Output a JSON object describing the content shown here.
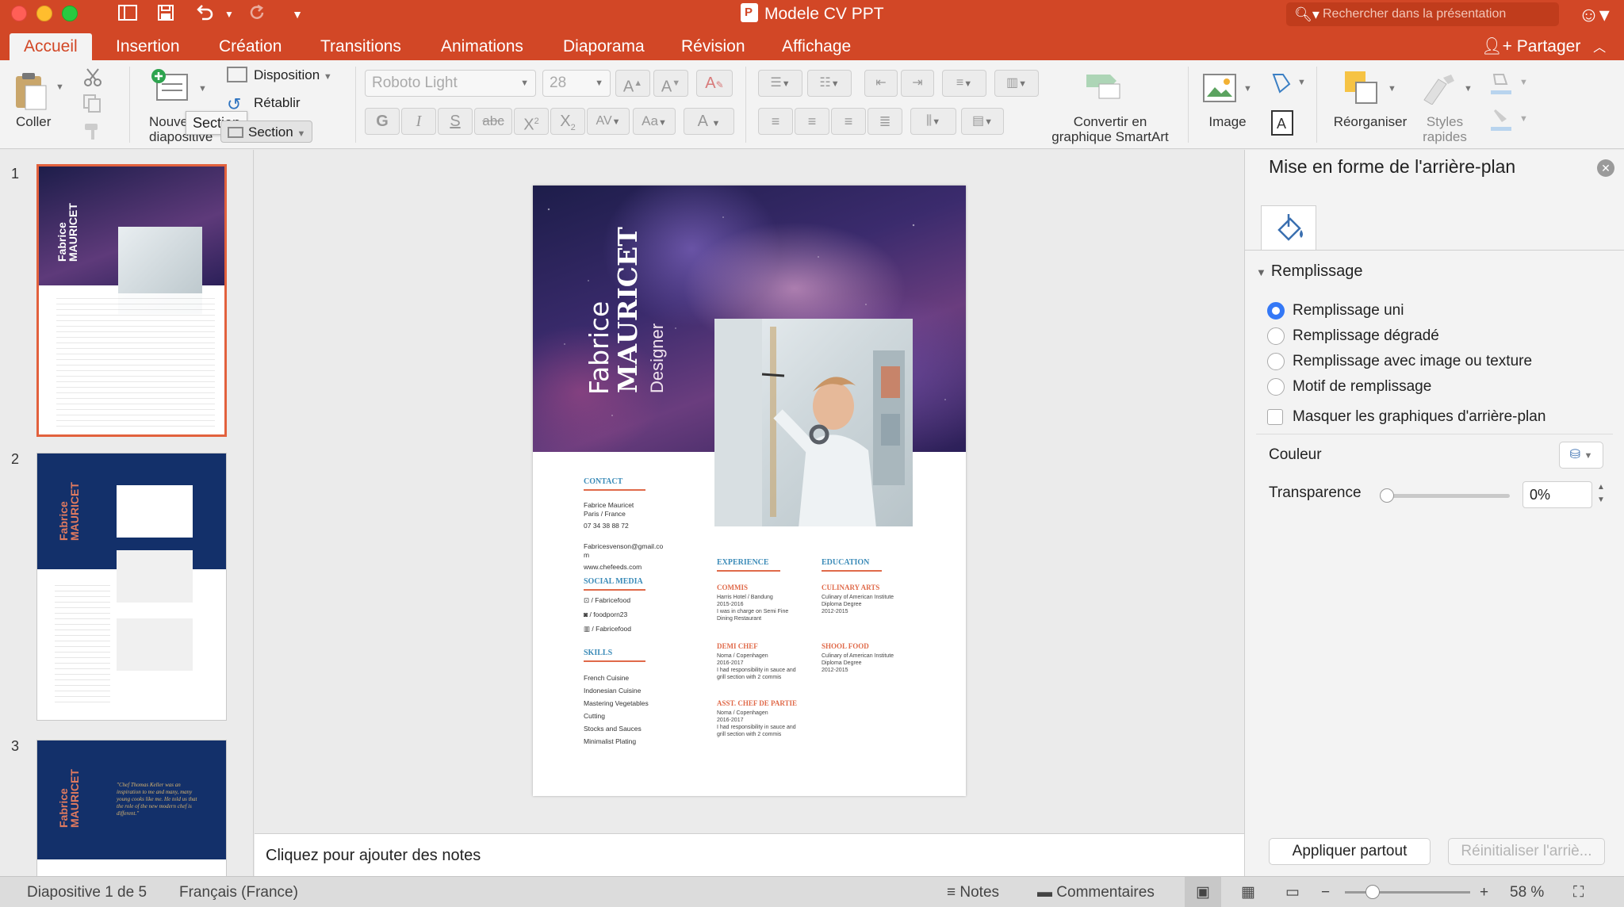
{
  "window": {
    "title": "Modele CV PPT",
    "search_placeholder": "Rechercher dans la présentation"
  },
  "tabs": [
    "Accueil",
    "Insertion",
    "Création",
    "Transitions",
    "Animations",
    "Diaporama",
    "Révision",
    "Affichage"
  ],
  "share_label": "Partager",
  "ribbon": {
    "paste_label": "Coller",
    "new_slide_label_1": "Nouve",
    "new_slide_label_2": "diapositive",
    "tooltip": "Section",
    "layout_label": "Disposition",
    "reset_label": "Rétablir",
    "section_label": "Section",
    "font_name": "Roboto Light",
    "font_size": "28",
    "convert_smartart_1": "Convertir en",
    "convert_smartart_2": "graphique SmartArt",
    "image_label": "Image",
    "arrange_label": "Réorganiser",
    "quick_styles_1": "Styles",
    "quick_styles_2": "rapides"
  },
  "thumbnails": {
    "numbers": [
      "1",
      "2",
      "3"
    ],
    "slide2_name1": "Fabrice",
    "slide2_name2": "MAURICET",
    "slide3_quote": "\"Chef Thomas Keller was an inspiration to me and many, many young cooks like me. He told us that the role of the new modern chef is different.\""
  },
  "slide": {
    "first_name": "Fabrice",
    "last_name": "MAURICET",
    "role": "Designer",
    "contact": {
      "heading": "CONTACT",
      "name": "Fabrice Mauricet",
      "city": "Paris / France",
      "phone": "07 34 38 88 72",
      "email_1": "Fabricesvenson@gmail.co",
      "email_2": "m",
      "website": "www.chefeeds.com"
    },
    "social": {
      "heading": "SOCIAL MEDIA",
      "items": [
        "/ Fabricefood",
        "/ foodporn23",
        "/ Fabricefood"
      ]
    },
    "skills": {
      "heading": "SKILLS",
      "items": [
        "French Cuisine",
        "Indonesian Cuisine",
        "Mastering Vegetables",
        "Cutting",
        "Stocks and Sauces",
        "Minimalist Plating"
      ]
    },
    "experience": {
      "heading": "EXPERIENCE",
      "jobs": [
        {
          "title": "COMMIS",
          "lines": [
            "Harris Hotel / Bandung",
            "2015-2016",
            "I was in charge on Semi Fine",
            "Dining Restaurant"
          ]
        },
        {
          "title": "DEMI CHEF",
          "lines": [
            "Noma / Copenhagen",
            "2016-2017",
            "I had responsibility in sauce and",
            "grill section with 2 commis"
          ]
        },
        {
          "title": "ASST. CHEF DE PARTIE",
          "lines": [
            "Noma / Copenhagen",
            "2016-2017",
            "I had responsibility in sauce and",
            "grill section with 2 commis"
          ]
        }
      ]
    },
    "education": {
      "heading": "EDUCATION",
      "items": [
        {
          "title": "CULINARY ARTS",
          "lines": [
            "Culinary of American Institute",
            "Diploma Degree",
            "2012-2015"
          ]
        },
        {
          "title": "SHOOL FOOD",
          "lines": [
            "Culinary of American Institute",
            "Diploma Degree",
            "2012-2015"
          ]
        }
      ]
    }
  },
  "notes_placeholder": "Cliquez pour ajouter des notes",
  "format_panel": {
    "title": "Mise en forme de l'arrière-plan",
    "section": "Remplissage",
    "options": [
      "Remplissage uni",
      "Remplissage dégradé",
      "Remplissage avec image ou texture",
      "Motif de remplissage"
    ],
    "selected_option": "Remplissage uni",
    "hide_graphics": "Masquer les graphiques d'arrière-plan",
    "color_label": "Couleur",
    "transparency_label": "Transparence",
    "transparency_value": "0%",
    "transparency_fraction": 0,
    "apply_all": "Appliquer partout",
    "reset": "Réinitialiser l'arriè..."
  },
  "status": {
    "slide_info": "Diapositive 1 de 5",
    "language": "Français (France)",
    "notes": "Notes",
    "comments": "Commentaires",
    "zoom": "58 %",
    "zoom_fraction": 0.58
  },
  "colors": {
    "accent": "#d24726",
    "slide_blue": "#3b8bb8",
    "slide_red": "#e06a4a",
    "navy": "#13306a",
    "radio_blue": "#3478f6"
  }
}
